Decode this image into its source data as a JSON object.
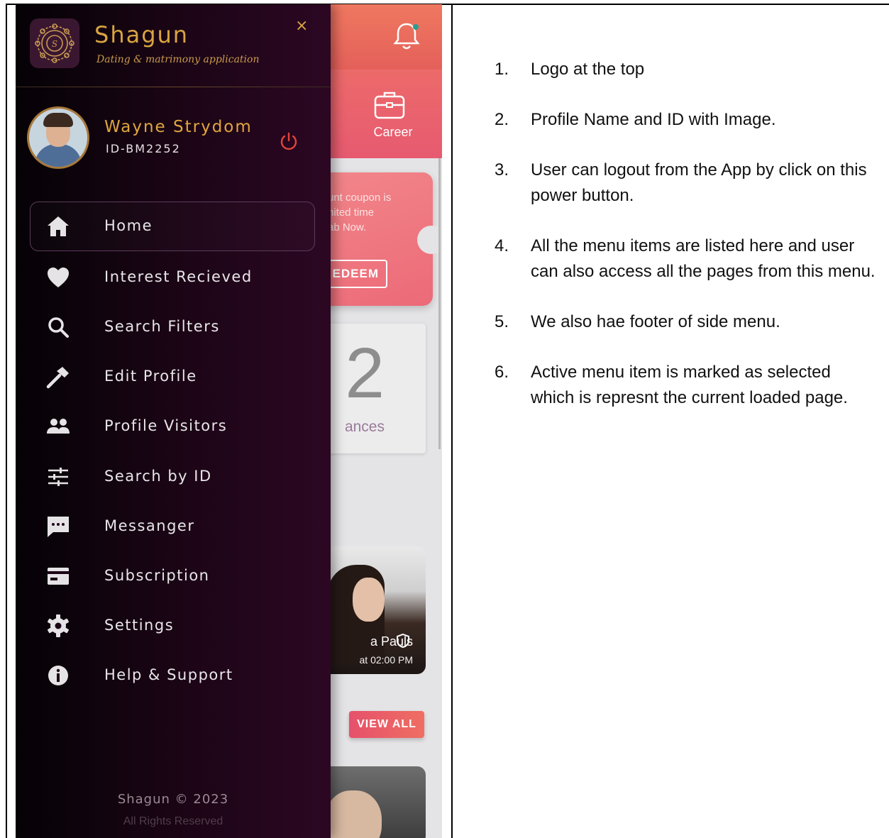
{
  "app": {
    "name": "Shagun",
    "tagline": "Dating & matrimony application",
    "close_symbol": "×"
  },
  "profile": {
    "name": "Wayne Strydom",
    "id": "ID-BM2252"
  },
  "menu": {
    "items": [
      {
        "label": "Home",
        "icon": "home-icon",
        "active": true
      },
      {
        "label": "Interest Recieved",
        "icon": "heart-icon",
        "active": false
      },
      {
        "label": "Search Filters",
        "icon": "search-icon",
        "active": false
      },
      {
        "label": "Edit Profile",
        "icon": "hammer-icon",
        "active": false
      },
      {
        "label": "Profile Visitors",
        "icon": "people-icon",
        "active": false
      },
      {
        "label": "Search by ID",
        "icon": "sliders-icon",
        "active": false
      },
      {
        "label": "Messanger",
        "icon": "chat-icon",
        "active": false
      },
      {
        "label": "Subscription",
        "icon": "card-icon",
        "active": false
      },
      {
        "label": "Settings",
        "icon": "gear-icon",
        "active": false
      },
      {
        "label": "Help & Support",
        "icon": "info-icon",
        "active": false
      }
    ]
  },
  "footer": {
    "copyright": "Shagun © 2023",
    "rights": "All Rights Reserved"
  },
  "background": {
    "career_label": "Career",
    "coupon_lines": [
      "unt coupon is",
      "nited time",
      "ab Now."
    ],
    "redeem_label": "EDEEM",
    "stats_number": "2",
    "stats_label": "ances",
    "profile_name": "a Pauls",
    "profile_time": "at 02:00 PM",
    "view_all_label": "VIEW ALL"
  },
  "notes": [
    {
      "num": "1.",
      "text": "Logo at the top"
    },
    {
      "num": "2.",
      "text": "Profile Name and ID with Image."
    },
    {
      "num": "3.",
      "text": "User can logout from the App by click on this power button."
    },
    {
      "num": "4.",
      "text": "All the menu items are listed here and user can also access all the pages from this menu."
    },
    {
      "num": "5.",
      "text": "We also hae footer of side menu."
    },
    {
      "num": "6.",
      "text": "Active menu item is marked as selected which is represnt the current loaded page."
    }
  ],
  "colors": {
    "accent_gold": "#d9a441",
    "drawer_bg": "#1c0516",
    "header_coral": "#ef7860"
  }
}
